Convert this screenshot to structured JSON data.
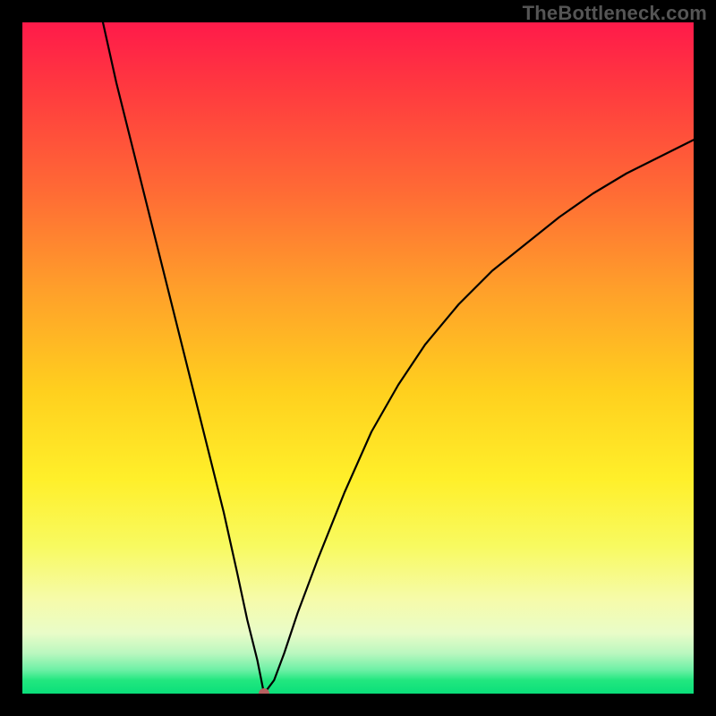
{
  "watermark": {
    "text": "TheBottleneck.com"
  },
  "chart_data": {
    "type": "line",
    "title": "",
    "xlabel": "",
    "ylabel": "",
    "xlim": [
      0,
      100
    ],
    "ylim": [
      0,
      100
    ],
    "grid": false,
    "legend": false,
    "background_gradient": [
      "#ff1a4a",
      "#ffd01e",
      "#22e77f"
    ],
    "marker": {
      "x": 36,
      "y": 0,
      "color": "#b76060",
      "radius_px": 6
    },
    "series": [
      {
        "name": "curve",
        "color": "#000000",
        "x": [
          12,
          14,
          16,
          18,
          20,
          22,
          24,
          26,
          28,
          30,
          32,
          33.5,
          35,
          36,
          37.5,
          39,
          41,
          44,
          48,
          52,
          56,
          60,
          65,
          70,
          75,
          80,
          85,
          90,
          95,
          100
        ],
        "y": [
          100,
          91,
          83,
          75,
          67,
          59,
          51,
          43,
          35,
          27,
          18,
          11,
          5,
          0,
          2,
          6,
          12,
          20,
          30,
          39,
          46,
          52,
          58,
          63,
          67,
          71,
          74.5,
          77.5,
          80,
          82.5
        ]
      }
    ]
  }
}
